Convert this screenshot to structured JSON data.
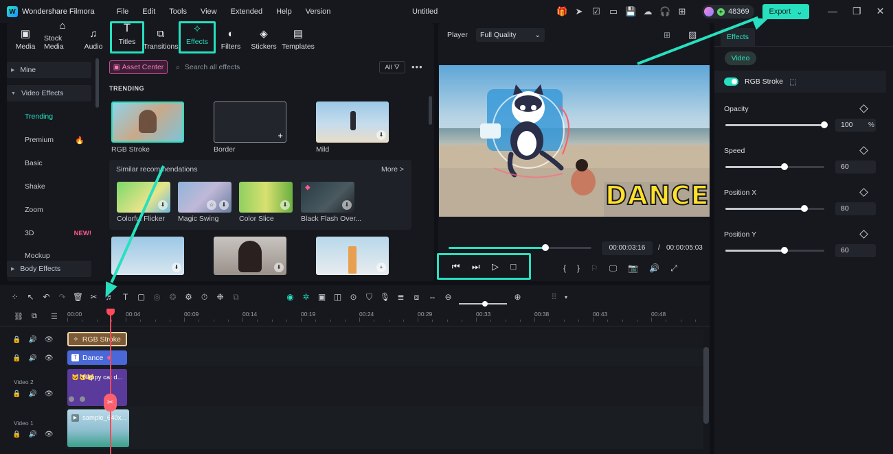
{
  "app": {
    "name": "Wondershare Filmora",
    "logo": "W",
    "project_title": "Untitled",
    "credits": "48369",
    "export_label": "Export"
  },
  "menu": [
    "File",
    "Edit",
    "Tools",
    "View",
    "Extended",
    "Help",
    "Version"
  ],
  "library_tabs": [
    {
      "label": "Media",
      "icon": "media-icon"
    },
    {
      "label": "Stock Media",
      "icon": "stock-media-icon"
    },
    {
      "label": "Audio",
      "icon": "audio-icon"
    },
    {
      "label": "Titles",
      "icon": "titles-icon"
    },
    {
      "label": "Transitions",
      "icon": "transitions-icon"
    },
    {
      "label": "Effects",
      "icon": "effects-icon"
    },
    {
      "label": "Filters",
      "icon": "filters-icon"
    },
    {
      "label": "Stickers",
      "icon": "stickers-icon"
    },
    {
      "label": "Templates",
      "icon": "templates-icon"
    }
  ],
  "sidebar": {
    "mine": "Mine",
    "video_effects": "Video Effects",
    "items": [
      "Trending",
      "Premium",
      "Basic",
      "Shake",
      "Zoom",
      "3D",
      "Mockup"
    ],
    "new_badge": "NEW!",
    "body_effects": "Body Effects"
  },
  "effects_panel": {
    "asset_center": "Asset Center",
    "search_placeholder": "Search all effects",
    "filter_all": "All",
    "section": "TRENDING",
    "trending": [
      "RGB Stroke",
      "Border",
      "Mild"
    ],
    "similar_title": "Similar recommendations",
    "more": "More >",
    "similar": [
      "Colorful Flicker",
      "Magic Swing",
      "Color Slice",
      "Black Flash Over..."
    ]
  },
  "player": {
    "label": "Player",
    "quality": "Full Quality",
    "overlay_text": "DANCE",
    "current_time": "00:00:03:16",
    "separator": "/",
    "total_time": "00:00:05:03",
    "progress": 0.68
  },
  "properties": {
    "tab": "Effects",
    "pill": "Video",
    "effect_name": "RGB Stroke",
    "params": [
      {
        "label": "Opacity",
        "value": "100",
        "unit": "%",
        "fraction": 1.0
      },
      {
        "label": "Speed",
        "value": "60",
        "unit": "",
        "fraction": 0.6
      },
      {
        "label": "Position X",
        "value": "80",
        "unit": "",
        "fraction": 0.8
      },
      {
        "label": "Position Y",
        "value": "60",
        "unit": "",
        "fraction": 0.6
      }
    ]
  },
  "timeline": {
    "ruler": [
      "00:00",
      "00:04",
      "00:09",
      "00:14",
      "00:19",
      "00:24",
      "00:29",
      "00:33",
      "00:38",
      "00:43",
      "00:48"
    ],
    "tracks": [
      {
        "label": "",
        "clip": "RGB Stroke"
      },
      {
        "label": "",
        "clip": "Dance"
      },
      {
        "label": "Video 2",
        "clip": "Happy cat d..."
      },
      {
        "label": "Video 1",
        "clip": "sample_640x..."
      }
    ]
  },
  "colors": {
    "accent": "#27e0c0",
    "playhead": "#ff4a5a",
    "asset": "#ff7ab8",
    "new": "#ff5a8a"
  }
}
